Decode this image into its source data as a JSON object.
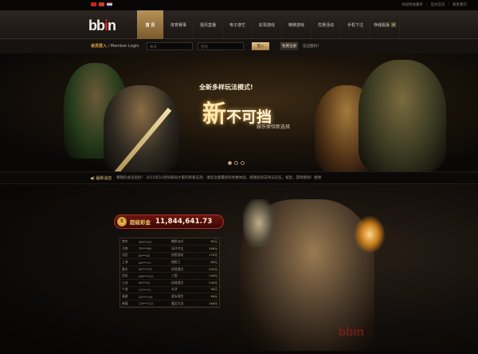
{
  "topbar": {
    "flags": [
      "cn-flag-icon",
      "hk-flag-icon",
      "us-flag-icon"
    ],
    "links": [
      "添加到收藏夹",
      "设为首页",
      "联系我们"
    ]
  },
  "nav": {
    "logo_pre": "bb",
    "logo_i": "i",
    "logo_post": "n",
    "items": [
      {
        "label": "首 页",
        "active": true
      },
      {
        "label": "体育赛事"
      },
      {
        "label": "视讯直播"
      },
      {
        "label": "电子游艺"
      },
      {
        "label": "彩票游戏"
      },
      {
        "label": "棋牌游戏"
      },
      {
        "label": "优惠活动"
      },
      {
        "label": "手机下注"
      },
      {
        "label": "存储看版"
      }
    ],
    "dropdown_glyph": "▾"
  },
  "login": {
    "title_cn": "会员登入",
    "title_en": " / Member Login",
    "username_placeholder": "帐号",
    "password_placeholder": "密码",
    "login_button": "登入",
    "register_button": "免费注册",
    "forgot": "忘记密码?"
  },
  "banner": {
    "subtitle": "全新多样玩法模式!",
    "big_char": "新",
    "big_rest": "不可挡",
    "tagline": "娱乐体验新选择",
    "slides": 3,
    "active_slide": 0
  },
  "news": {
    "label": "最新消息",
    "text": "尊敬的会员您好！ 2015年10月份期间大家的积极支持，请您注意最新的优惠体验，感谢您的支持与信任，祝您，游戏愉快！谢谢"
  },
  "jackpot": {
    "label": "超级彩金",
    "value": "11,844,641.73",
    "coin": "$"
  },
  "winners": [
    {
      "city": "南京",
      "user": "YM***05",
      "game": "糖果派对",
      "amount": "69元"
    },
    {
      "city": "河南",
      "user": "TD***88",
      "game": "连环夺宝",
      "amount": "168元"
    },
    {
      "city": "沈阳",
      "user": "BI***45",
      "game": "拼图游戏",
      "amount": "178元"
    },
    {
      "city": "上海",
      "user": "AS***11",
      "game": "捕鱼王",
      "amount": "88元"
    },
    {
      "city": "重庆",
      "user": "W***155",
      "game": "秘境冒险",
      "amount": "339元"
    },
    {
      "city": "西安",
      "user": "HH***222",
      "game": "三国",
      "amount": "148元"
    },
    {
      "city": "江苏",
      "user": "W***45",
      "game": "秘境冒险",
      "amount": "336元"
    },
    {
      "city": "宁波",
      "user": "CC***11",
      "game": "水浒",
      "amount": "96元"
    },
    {
      "city": "福建",
      "user": "LK***155",
      "game": "星际探险",
      "amount": "66元"
    },
    {
      "city": "新疆",
      "user": "CD***222",
      "game": "魔龙大战",
      "amount": "188元"
    }
  ],
  "watermark": "bbin",
  "colors": {
    "accent": "#b89158",
    "jackpot_red": "#6b150f",
    "brand_red": "#d22"
  }
}
